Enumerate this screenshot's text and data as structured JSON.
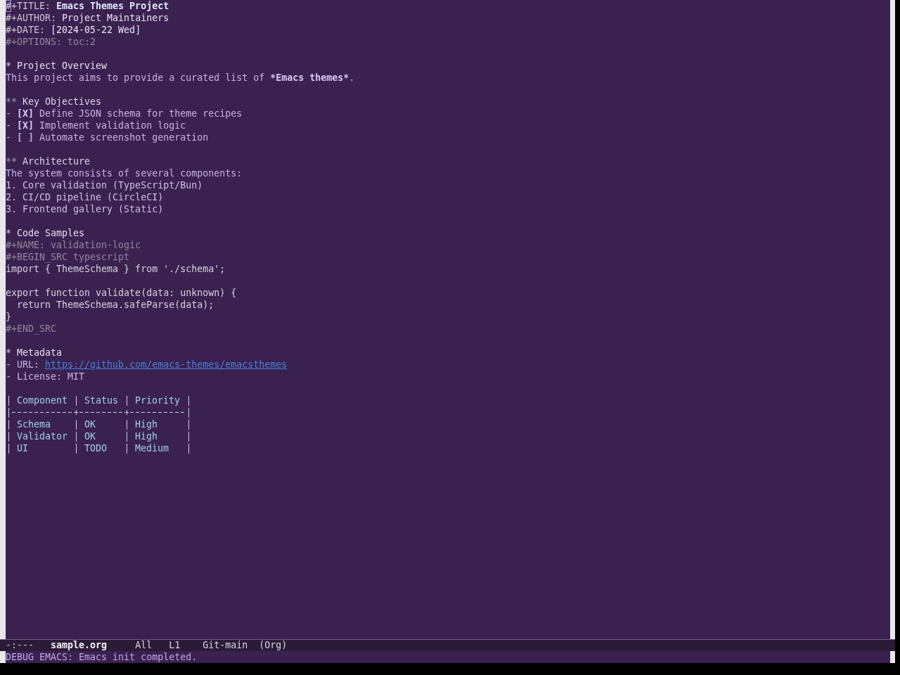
{
  "keywords": [
    {
      "kind": "title",
      "key": "#+TITLE:",
      "value": "Emacs Themes Project",
      "cursor": true
    },
    {
      "kind": "author",
      "key": "#+AUTHOR:",
      "value": "Project Maintainers",
      "cursor": false
    },
    {
      "kind": "date",
      "key": "#+DATE:",
      "value": "[2024-05-22 Wed]",
      "cursor": false
    },
    {
      "kind": "option",
      "key": "#+OPTIONS:",
      "value": "toc:2",
      "cursor": false
    }
  ],
  "outline": [
    {
      "stars": "*",
      "title": "Project Overview",
      "blocks": [
        {
          "kind": "paragraph",
          "parts": [
            {
              "text": "This project aims to provide a curated list of ",
              "bold": false
            },
            {
              "text": "*Emacs themes*",
              "bold": true
            },
            {
              "text": ".",
              "bold": false
            }
          ]
        }
      ],
      "children": [
        {
          "stars": "**",
          "title": "Key Objectives",
          "blocks": [
            {
              "kind": "checklist",
              "items": [
                {
                  "bullet": "-",
                  "box": "[X]",
                  "checked": true,
                  "text": "Define JSON schema for theme recipes"
                },
                {
                  "bullet": "-",
                  "box": "[X]",
                  "checked": true,
                  "text": "Implement validation logic"
                },
                {
                  "bullet": "-",
                  "box": "[ ]",
                  "checked": false,
                  "text": "Automate screenshot generation"
                }
              ]
            }
          ]
        },
        {
          "stars": "**",
          "title": "Architecture",
          "blocks": [
            {
              "kind": "paragraph",
              "parts": [
                {
                  "text": "The system consists of several components:",
                  "bold": false
                }
              ]
            },
            {
              "kind": "ordered_list",
              "items": [
                {
                  "number": "1.",
                  "text": "Core validation (TypeScript/Bun)"
                },
                {
                  "number": "2.",
                  "text": "CI/CD pipeline (CircleCI)"
                },
                {
                  "number": "3.",
                  "text": "Frontend gallery (Static)"
                }
              ]
            }
          ]
        }
      ]
    },
    {
      "stars": "*",
      "title": "Code Samples",
      "blocks": [
        {
          "kind": "meta",
          "key": "#+NAME:",
          "value": "validation-logic"
        },
        {
          "kind": "meta",
          "key": "#+BEGIN_SRC",
          "value": "typescript"
        },
        {
          "kind": "code",
          "text": "import { ThemeSchema } from './schema';\n\nexport function validate(data: unknown) {\n  return ThemeSchema.safeParse(data);\n}"
        },
        {
          "kind": "meta",
          "key": "#+END_SRC"
        }
      ]
    },
    {
      "stars": "*",
      "title": "Metadata",
      "blocks": [
        {
          "kind": "list",
          "items": [
            {
              "bullet": "-",
              "label": "URL:",
              "link": "https://github.com/emacs-themes/emacsthemes"
            },
            {
              "bullet": "-",
              "text": "License: MIT"
            }
          ]
        },
        {
          "kind": "table",
          "columns": [
            "Component",
            "Status",
            "Priority"
          ],
          "rows": [
            [
              "Schema",
              "OK",
              "High"
            ],
            [
              "Validator",
              "OK",
              "High"
            ],
            [
              "UI",
              "TODO",
              "Medium"
            ]
          ]
        }
      ]
    }
  ],
  "mode_line": {
    "state": "-:---",
    "buffer_name": "sample.org",
    "position": "All",
    "line": "L1",
    "branch": "Git-main",
    "major_mode": "(Org)"
  },
  "echo_area": {
    "message": "DEBUG EMACS: Emacs init completed."
  }
}
